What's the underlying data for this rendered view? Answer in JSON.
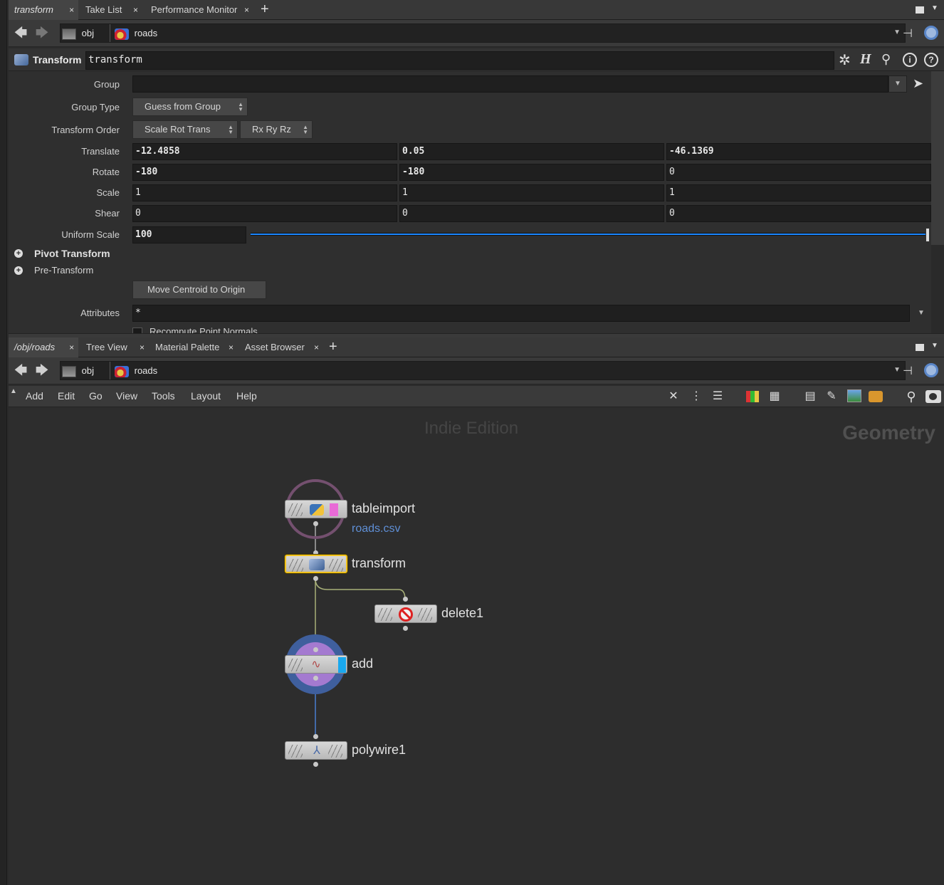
{
  "top_tabs": [
    {
      "label": "transform",
      "active": true
    },
    {
      "label": "Take List",
      "active": false
    },
    {
      "label": "Performance Monitor",
      "active": false
    }
  ],
  "bottom_tabs": [
    {
      "label": "/obj/roads",
      "active": true
    },
    {
      "label": "Tree View",
      "active": false
    },
    {
      "label": "Material Palette",
      "active": false
    },
    {
      "label": "Asset Browser",
      "active": false
    }
  ],
  "path": {
    "obj": "obj",
    "node": "roads"
  },
  "param_header": {
    "type": "Transform",
    "name": "transform"
  },
  "params": {
    "group_label": "Group",
    "group_value": "",
    "group_type_label": "Group Type",
    "group_type_value": "Guess from Group",
    "transform_order_label": "Transform Order",
    "transform_order_value": "Scale Rot Trans",
    "rotation_order_value": "Rx Ry Rz",
    "translate_label": "Translate",
    "translate": [
      "-12.4858",
      "0.05",
      "-46.1369"
    ],
    "rotate_label": "Rotate",
    "rotate": [
      "-180",
      "-180",
      "0"
    ],
    "scale_label": "Scale",
    "scale": [
      "1",
      "1",
      "1"
    ],
    "shear_label": "Shear",
    "shear": [
      "0",
      "0",
      "0"
    ],
    "uniform_scale_label": "Uniform Scale",
    "uniform_scale_value": "100",
    "pivot_transform_label": "Pivot Transform",
    "pre_transform_label": "Pre-Transform",
    "move_centroid_label": "Move Centroid to Origin",
    "attributes_label": "Attributes",
    "attributes_value": "*",
    "recompute_label": "Recompute Point Normals"
  },
  "menu": [
    "Add",
    "Edit",
    "Go",
    "View",
    "Tools",
    "Layout",
    "Help"
  ],
  "network": {
    "watermark": "Indie Edition",
    "context": "Geometry",
    "nodes": {
      "tableimport": {
        "name": "tableimport",
        "sub": "roads.csv"
      },
      "transform": {
        "name": "transform"
      },
      "delete1": {
        "name": "delete1"
      },
      "add": {
        "name": "add"
      },
      "polywire1": {
        "name": "polywire1"
      }
    }
  },
  "colors": {
    "accent_blue": "#1a86ff",
    "selected": "#f2c21b",
    "python_ring": "#7a4a74"
  }
}
